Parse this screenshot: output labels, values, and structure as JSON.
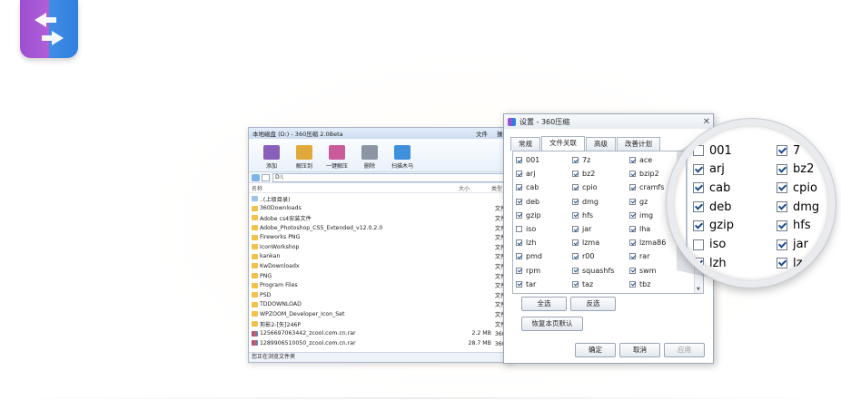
{
  "file_manager": {
    "title": "本地磁盘 (D:) - 360压缩 2.0Beta",
    "menu": [
      "文件",
      "操作"
    ],
    "toolbar": [
      {
        "label": "添加",
        "icon": "add-archive-icon",
        "color": "#8a5fb8"
      },
      {
        "label": "解压到",
        "icon": "extract-to-icon",
        "color": "#e0a93a"
      },
      {
        "label": "一键解压",
        "icon": "one-click-extract-icon",
        "color": "#c95b9a"
      },
      {
        "label": "删除",
        "icon": "delete-icon",
        "color": "#8c96a3"
      },
      {
        "label": "扫描木马",
        "icon": "scan-trojan-icon",
        "color": "#3f8fdc"
      }
    ],
    "address": "D:\\",
    "columns": [
      "名称",
      "大小",
      "类型"
    ],
    "rows": [
      {
        "name": "..(上级目录)",
        "size": "",
        "type": "",
        "kind": "up"
      },
      {
        "name": "360Downloads",
        "size": "",
        "type": "文件夹",
        "kind": "folder"
      },
      {
        "name": "Adobe cs4安装文件",
        "size": "",
        "type": "文件夹",
        "kind": "folder"
      },
      {
        "name": "Adobe_Photoshop_CS5_Extended_v12.0.2.0",
        "size": "",
        "type": "文件夹",
        "kind": "folder"
      },
      {
        "name": "Fireworks PNG",
        "size": "",
        "type": "文件夹",
        "kind": "folder"
      },
      {
        "name": "IconWorkshop",
        "size": "",
        "type": "文件夹",
        "kind": "folder"
      },
      {
        "name": "kankan",
        "size": "",
        "type": "文件夹",
        "kind": "folder"
      },
      {
        "name": "KwDownloadx",
        "size": "",
        "type": "文件夹",
        "kind": "folder"
      },
      {
        "name": "PNG",
        "size": "",
        "type": "文件夹",
        "kind": "folder"
      },
      {
        "name": "Program Files",
        "size": "",
        "type": "文件夹",
        "kind": "folder"
      },
      {
        "name": "PSD",
        "size": "",
        "type": "文件夹",
        "kind": "folder"
      },
      {
        "name": "TDDOWNLOAD",
        "size": "",
        "type": "文件夹",
        "kind": "folder"
      },
      {
        "name": "WPZOOM_Developer_Icon_Set",
        "size": "",
        "type": "文件夹",
        "kind": "folder"
      },
      {
        "name": "剪影2-[矢]246P",
        "size": "",
        "type": "文件夹",
        "kind": "folder"
      },
      {
        "name": "1256697063442_zcool.com.cn.rar",
        "size": "2.2 MB",
        "type": "360压",
        "kind": "rar"
      },
      {
        "name": "1289906510050_zcool.com.cn.rar",
        "size": "28.7 MB",
        "type": "360压",
        "kind": "rar"
      }
    ],
    "status": "您正在浏览文件夹"
  },
  "settings": {
    "title": "设置 - 360压缩",
    "tabs": [
      "常规",
      "文件关联",
      "高级",
      "改善计划"
    ],
    "active_tab": 1,
    "formats": [
      [
        {
          "ext": "001",
          "on": true
        },
        {
          "ext": "arj",
          "on": true
        },
        {
          "ext": "cab",
          "on": true
        },
        {
          "ext": "deb",
          "on": true
        },
        {
          "ext": "gzip",
          "on": true
        },
        {
          "ext": "iso",
          "on": false
        },
        {
          "ext": "lzh",
          "on": true
        },
        {
          "ext": "pmd",
          "on": true
        },
        {
          "ext": "rpm",
          "on": true
        },
        {
          "ext": "tar",
          "on": true
        }
      ],
      [
        {
          "ext": "7z",
          "on": true
        },
        {
          "ext": "bz2",
          "on": true
        },
        {
          "ext": "cpio",
          "on": true
        },
        {
          "ext": "dmg",
          "on": true
        },
        {
          "ext": "hfs",
          "on": true
        },
        {
          "ext": "jar",
          "on": true
        },
        {
          "ext": "lzma",
          "on": true
        },
        {
          "ext": "r00",
          "on": true
        },
        {
          "ext": "squashfs",
          "on": true
        },
        {
          "ext": "taz",
          "on": true
        }
      ],
      [
        {
          "ext": "ace",
          "on": true
        },
        {
          "ext": "bzip2",
          "on": true
        },
        {
          "ext": "cramfs",
          "on": true
        },
        {
          "ext": "gz",
          "on": true
        },
        {
          "ext": "img",
          "on": true
        },
        {
          "ext": "lha",
          "on": true
        },
        {
          "ext": "lzma86",
          "on": true
        },
        {
          "ext": "rar",
          "on": true
        },
        {
          "ext": "swm",
          "on": true
        },
        {
          "ext": "tbz",
          "on": true
        }
      ]
    ],
    "select_all": "全选",
    "invert": "反选",
    "restore_defaults": "恢复本页默认",
    "ok": "确定",
    "cancel": "取消",
    "apply": "应用"
  },
  "magnifier": {
    "col1": [
      {
        "ext": "001",
        "on": false
      },
      {
        "ext": "arj",
        "on": true
      },
      {
        "ext": "cab",
        "on": true
      },
      {
        "ext": "deb",
        "on": true
      },
      {
        "ext": "gzip",
        "on": true
      },
      {
        "ext": "iso",
        "on": false
      },
      {
        "ext": "lzh",
        "on": true
      }
    ],
    "col2": [
      {
        "ext": "7",
        "on": true
      },
      {
        "ext": "bz2",
        "on": true
      },
      {
        "ext": "cpio",
        "on": true
      },
      {
        "ext": "dmg",
        "on": true
      },
      {
        "ext": "hfs",
        "on": true
      },
      {
        "ext": "jar",
        "on": true
      },
      {
        "ext": "lz",
        "on": true
      }
    ]
  },
  "colors": {
    "accent": "#3f8de4",
    "brand_purple": "#9b4fd0"
  }
}
